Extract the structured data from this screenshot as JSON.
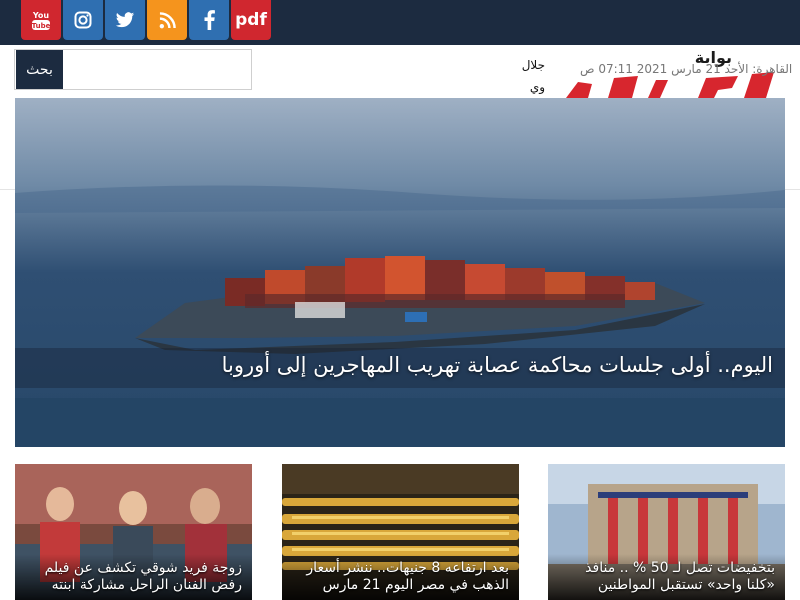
{
  "social": [
    {
      "name": "youtube-icon",
      "color": "#d0272f"
    },
    {
      "name": "instagram-icon",
      "color": "#2f6fb1"
    },
    {
      "name": "twitter-icon",
      "color": "#2f6fb1"
    },
    {
      "name": "rss-icon",
      "color": "#f5941d"
    },
    {
      "name": "facebook-icon",
      "color": "#2f6fb1"
    },
    {
      "name": "pdf-link",
      "label": "pdf",
      "color": "#d0272f"
    }
  ],
  "header": {
    "search_button": "بحث",
    "search_placeholder": "",
    "ticker_text": "جلال وي",
    "logo_small": "بوابة",
    "date": "القاهرة: الأحد 21 مارس 2021 07:11 ص"
  },
  "hero": {
    "title": "اليوم.. أولى جلسات محاكمة عصابة تهريب المهاجرين إلى أوروبا"
  },
  "cards": [
    {
      "title": "زوجة فريد شوقي تكشف عن فيلم رفض الفنان الراحل مشاركة ابنته"
    },
    {
      "title": "بعد ارتفاعه 8 جنيهات.. ننشر أسعار الذهب في مصر اليوم 21 مارس"
    },
    {
      "title": "بتخفيضات تصل لـ 50 % .. منافذ «كلنا واحد» تستقبل المواطنين"
    }
  ],
  "colors": {
    "topbar": "#1c2b40",
    "accent_red": "#d0272f",
    "accent_blue": "#2f6fb1",
    "accent_orange": "#f5941d"
  }
}
